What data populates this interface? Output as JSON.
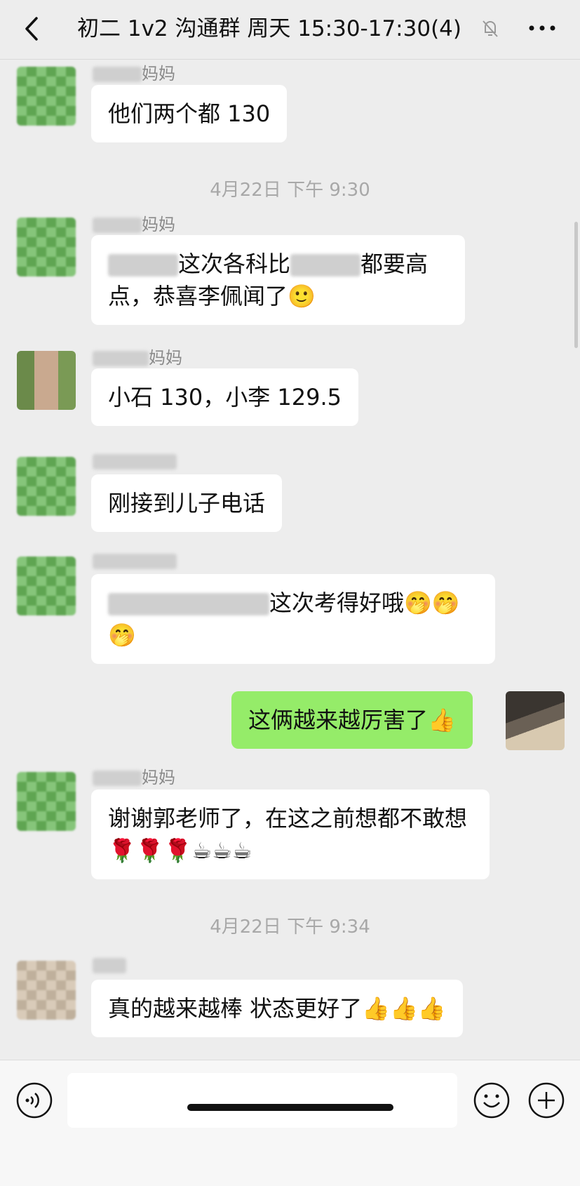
{
  "header": {
    "title": "初二 1v2 沟通群 周天 15:30-17:30(4)",
    "back_icon": "chevron-left-icon",
    "mute_icon": "bell-slash-icon",
    "more_icon": "ellipsis-icon"
  },
  "timestamps": [
    "4月22日 下午 9:30",
    "4月22日 下午 9:34"
  ],
  "messages": [
    {
      "name": "妈妈",
      "text": "他们两个都 130"
    },
    {
      "name": "妈妈",
      "text_before": "这次各科比",
      "text_after": "都要高点，恭喜李佩闻了🙂"
    },
    {
      "name": "妈妈",
      "text": "小石 130，小李 129.5"
    },
    {
      "name": "",
      "text": "刚接到儿子电话"
    },
    {
      "name": "",
      "text": "这次考得好哦🤭🤭🤭"
    },
    {
      "name": "",
      "text": "这俩越来越厉害了👍",
      "mine": true
    },
    {
      "name": "妈妈",
      "text": "谢谢郭老师了，在这之前想都不敢想🌹🌹🌹☕☕☕"
    },
    {
      "name": "",
      "text": "真的越来越棒 状态更好了👍👍👍"
    }
  ],
  "inputbar": {
    "voice_icon": "voice-icon",
    "emoji_icon": "emoji-icon",
    "plus_icon": "plus-icon"
  }
}
